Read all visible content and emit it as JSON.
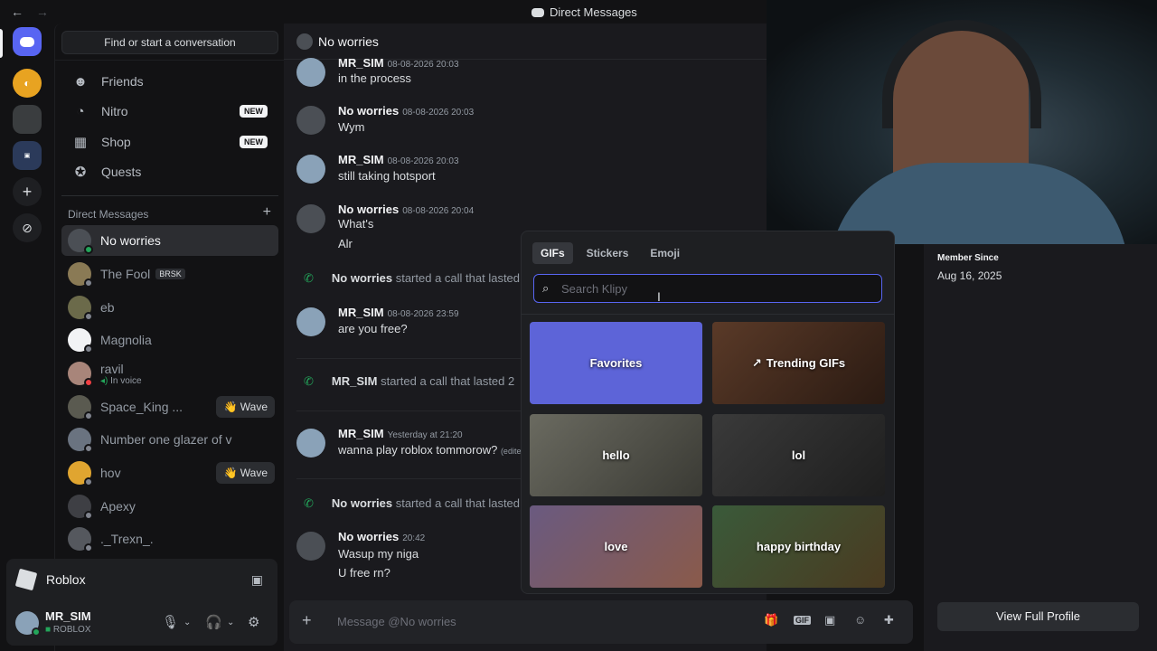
{
  "titlebar": {
    "back": "←",
    "forward": "→",
    "title": "Direct Messages"
  },
  "sidebar": {
    "search_label": "Find or start a conversation",
    "nav": [
      {
        "label": "Friends",
        "icon": "friends-icon",
        "glyph": "☻"
      },
      {
        "label": "Nitro",
        "icon": "nitro-icon",
        "glyph": "◔",
        "badge": "NEW"
      },
      {
        "label": "Shop",
        "icon": "shop-icon",
        "glyph": "▦",
        "badge": "NEW"
      },
      {
        "label": "Quests",
        "icon": "quests-icon",
        "glyph": "✪"
      }
    ],
    "dm_header": "Direct Messages",
    "dms": [
      {
        "name": "No worries"
      },
      {
        "name": "The Fool",
        "tag": "BRSK"
      },
      {
        "name": "eb"
      },
      {
        "name": "Magnolia"
      },
      {
        "name": "ravil",
        "sub": "In voice"
      },
      {
        "name": "Space_King ...",
        "wave": "👋 Wave"
      },
      {
        "name": "Number one glazer of v"
      },
      {
        "name": "hov",
        "wave": "👋 Wave"
      },
      {
        "name": "Apexy"
      },
      {
        "name": "._Trexn_."
      }
    ]
  },
  "activity": {
    "name": "Roblox"
  },
  "user": {
    "name": "MR_SIM",
    "status": "ROBLOX"
  },
  "chat": {
    "header": "No worries",
    "messages": [
      {
        "author": "MR_SIM",
        "time": "08-08-2026 20:03",
        "lines": [
          "in the process"
        ]
      },
      {
        "author": "No worries",
        "time": "08-08-2026 20:03",
        "lines": [
          "Wym"
        ]
      },
      {
        "author": "MR_SIM",
        "time": "08-08-2026 20:03",
        "lines": [
          "still taking hotsport"
        ]
      },
      {
        "author": "No worries",
        "time": "08-08-2026 20:04",
        "lines": [
          "What's",
          "Alr"
        ]
      },
      {
        "author": "MR_SIM",
        "time": "08-08-2026 23:59",
        "lines": [
          "are you free?"
        ]
      },
      {
        "author": "MR_SIM",
        "time": "Yesterday at 21:20",
        "lines": [
          "wanna play roblox tommorow?"
        ],
        "edited": "(edited)"
      },
      {
        "author": "No worries",
        "time": "20:42",
        "lines": [
          "Wasup my niga",
          "U free rn?"
        ]
      }
    ],
    "calls": [
      {
        "who": "No worries",
        "text": "started a call that lasted"
      },
      {
        "who": "MR_SIM",
        "text": "started a call that lasted 2"
      },
      {
        "who": "No worries",
        "text": "started a call that lasted"
      }
    ],
    "composer_placeholder": "Message @No worries"
  },
  "picker": {
    "tabs": [
      "GIFs",
      "Stickers",
      "Emoji"
    ],
    "search_placeholder": "Search Klipy",
    "tiles": [
      "Favorites",
      "Trending GIFs",
      "hello",
      "lol",
      "love",
      "happy birthday"
    ]
  },
  "profile": {
    "member_since_label": "Member Since",
    "member_since": "Aug 16, 2025",
    "view_full": "View Full Profile"
  },
  "colors": {
    "accent": "#5865f2",
    "online": "#23a55a",
    "bg": "#1a1a1e"
  }
}
